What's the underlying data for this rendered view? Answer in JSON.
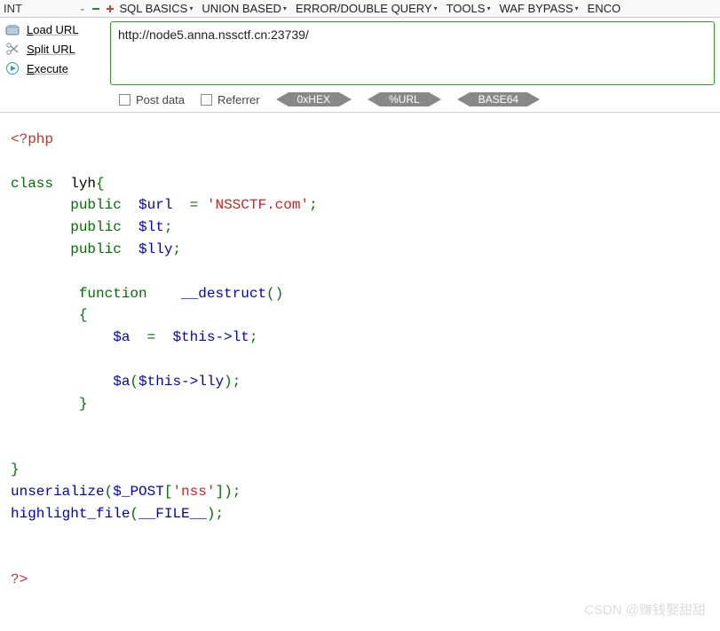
{
  "toolbar": {
    "int_label": "INT",
    "menus": [
      {
        "label": "SQL BASICS"
      },
      {
        "label": "UNION BASED"
      },
      {
        "label": "ERROR/DOUBLE QUERY"
      },
      {
        "label": "TOOLS"
      },
      {
        "label": "WAF BYPASS"
      },
      {
        "label": "ENCO"
      }
    ]
  },
  "side": {
    "load": "Load URL",
    "split": "Split URL",
    "execute": "Execute"
  },
  "url": {
    "value": "http://node5.anna.nssctf.cn:23739/"
  },
  "options": {
    "postdata": "Post data",
    "referrer": "Referrer",
    "hex": "0xHEX",
    "url": "%URL",
    "base64": "BASE64"
  },
  "code": {
    "open_tag": "<?php",
    "kw_class": "class",
    "class_name": "lyh",
    "lbrace": "{",
    "kw_public": "public",
    "var_url": "$url",
    "eq": "=",
    "str_nss": "'NSSCTF.com'",
    "semi": ";",
    "var_lt": "$lt",
    "var_lly": "$lly",
    "kw_function": "function",
    "fn_destruct": "__destruct",
    "parens": "()",
    "var_a": "$a",
    "this_lt": "$this->lt",
    "this_lly": "$this->lly",
    "rbrace": "}",
    "fn_unserialize": "unserialize",
    "post": "$_POST",
    "sq_l": "[",
    "str_nsskey": "'nss'",
    "sq_r": "]",
    "rp": ")",
    "lp": "(",
    "fn_highlight": "highlight_file",
    "file_c": "__FILE__",
    "close_tag": "?>"
  },
  "watermark": "CSDN @赚钱娶甜甜"
}
